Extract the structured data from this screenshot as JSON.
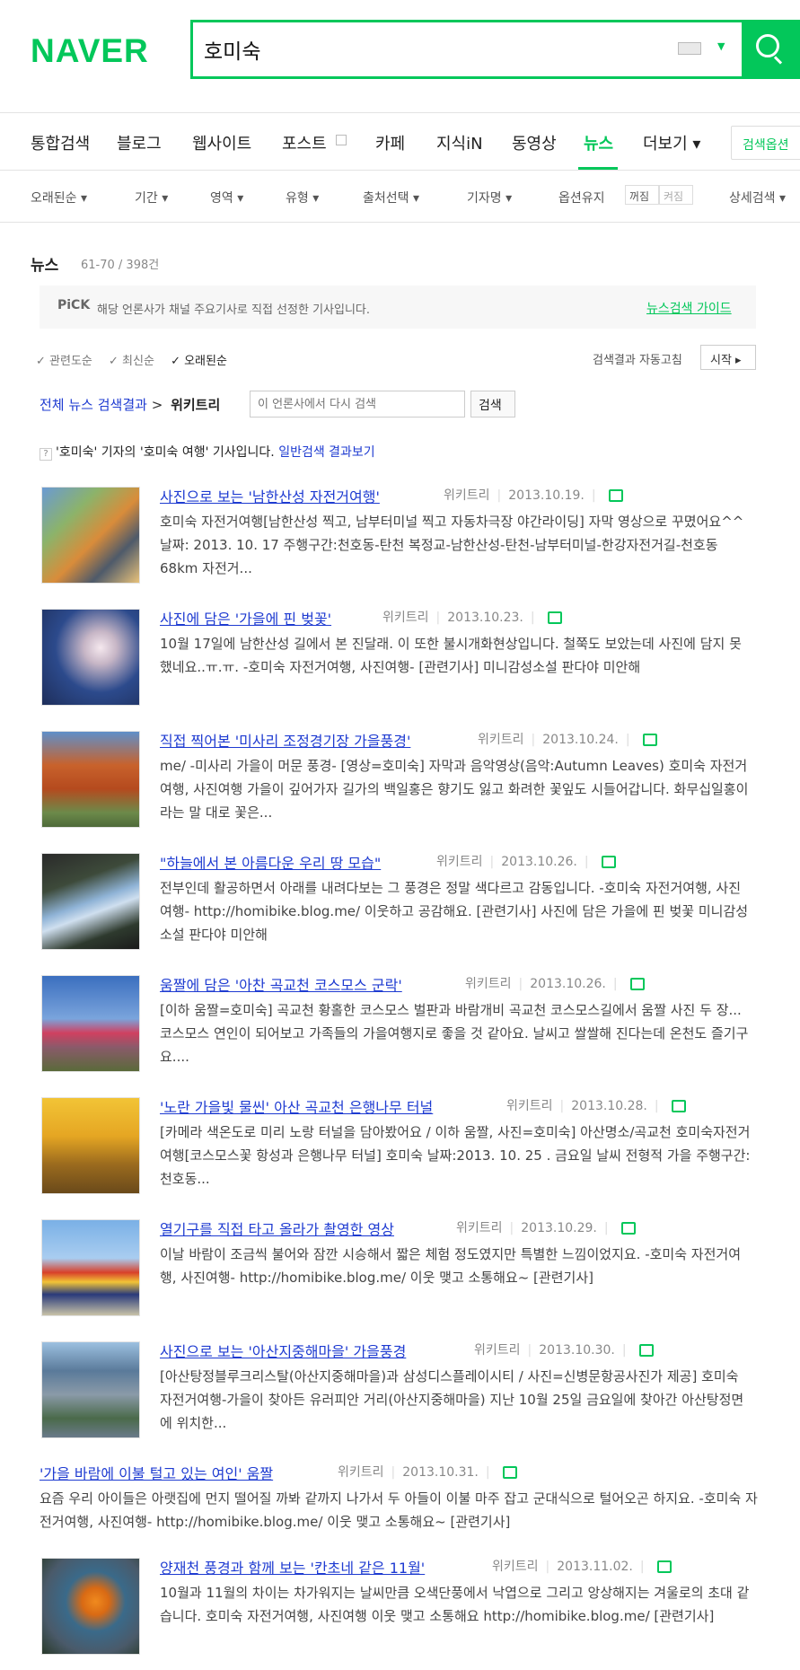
{
  "header": {
    "logo": "NAVER",
    "query": "호미숙"
  },
  "tabs": [
    "통합검색",
    "블로그",
    "웹사이트",
    "포스트",
    "카페",
    "지식iN",
    "동영상",
    "뉴스",
    "더보기 ▾"
  ],
  "search_options_label": "검색옵션",
  "filters": [
    "오래된순 ▾",
    "기간 ▾",
    "영역 ▾",
    "유형 ▾",
    "출처선택 ▾",
    "기자명 ▾",
    "옵션유지",
    "상세검색 ▾"
  ],
  "toggle": {
    "on": "꺼짐",
    "off": "켜짐"
  },
  "section": {
    "title": "뉴스",
    "count": "61-70 / 398건"
  },
  "pick": {
    "badge": "PiCK",
    "text": "해당 언론사가 채널 주요기사로 직접 선정한 기사입니다.",
    "guide": "뉴스검색 가이드"
  },
  "sort": {
    "relevance": "✓ 관련도순",
    "latest": "✓ 최신순",
    "oldest": "✓ 오래된순"
  },
  "auto_refresh": {
    "label": "검색결과 자동고침",
    "start": "시작 ▸"
  },
  "breadcrumb": {
    "all": "전체 뉴스 검색결과",
    "sep": ">",
    "current": "위키트리"
  },
  "research": {
    "placeholder": "이 언론사에서 다시 검색",
    "button": "검색"
  },
  "notice": {
    "pre": "'호미숙' 기자의 '호미숙 여행' 기사입니다.",
    "link": "일반검색 결과보기"
  },
  "results": [
    {
      "title": "사진으로 보는 '남한산성 자전거여행'",
      "source": "위키트리",
      "date": "2013.10.19.",
      "desc": "호미숙 자전거여행[남한산성 찍고, 남부터미널 찍고 자동차극장 야간라이딩] 자막 영상으로 꾸몄어요^^ 날짜: 2013. 10. 17 주행구간:천호동-탄천 복정교-남한산성-탄천-남부터미널-한강자전거길-천호동 68km 자전거..."
    },
    {
      "title": "사진에 담은 '가을에 핀 벚꽃'",
      "source": "위키트리",
      "date": "2013.10.23.",
      "desc": "10월 17일에 남한산성 길에서 본 진달래. 이 또한 불시개화현상입니다. 철쭉도 보았는데 사진에 담지 못했네요..ㅠ.ㅠ. -호미숙 자전거여행, 사진여행- [관련기사] 미니감성소설 판다야 미안해"
    },
    {
      "title": "직접 찍어본 '미사리 조정경기장 가을풍경'",
      "source": "위키트리",
      "date": "2013.10.24.",
      "desc": "me/ -미사리 가을이 머문 풍경- [영상=호미숙] 자막과 음악영상(음악:Autumn Leaves) 호미숙 자전거여행, 사진여행 가을이 깊어가자 길가의 백일홍은 향기도 잃고 화려한 꽃잎도 시들어갑니다. 화무십일홍이라는 말 대로 꽃은..."
    },
    {
      "title": "\"하늘에서 본 아름다운 우리 땅 모습\"",
      "source": "위키트리",
      "date": "2013.10.26.",
      "desc": "전부인데 활공하면서 아래를 내려다보는 그 풍경은 정말 색다르고 감동입니다. -호미숙 자전거여행, 사진여행- http://homibike.blog.me/ 이웃하고 공감해요. [관련기사] 사진에 담은 가을에 핀 벚꽃 미니감성소설 판다야 미안해"
    },
    {
      "title": "움짤에 담은 '아찬 곡교천 코스모스 군락'",
      "source": "위키트리",
      "date": "2013.10.26.",
      "desc": "[이하 움짤=호미숙] 곡교천 황홀한 코스모스 벌판과 바람개비 곡교천 코스모스길에서 움짤 사진 두 장... 코스모스 연인이 되어보고 가족들의 가을여행지로 좋을 것 같아요. 날씨고 쌀쌀해 진다는데 온천도 즐기구요...."
    },
    {
      "title": "'노란 가을빛 물씬' 아산 곡교천 은행나무 터널",
      "source": "위키트리",
      "date": "2013.10.28.",
      "desc": "[카메라 색온도로 미리 노랑 터널을 담아봤어요 / 이하 움짤, 사진=호미숙] 아산명소/곡교천 호미숙자전거여행[코스모스꽃 항성과 은행나무 터널] 호미숙 날짜:2013. 10. 25 . 금요일 날씨 전형적 가을 주행구간:천호동..."
    },
    {
      "title": "열기구를 직접 타고 올라가 촬영한 영상",
      "source": "위키트리",
      "date": "2013.10.29.",
      "desc": "이날 바람이 조금씩 불어와 잠깐 시승해서 짧은 체험 정도였지만 특별한 느낌이었지요. -호미숙 자전거여행, 사진여행- http://homibike.blog.me/ 이웃 맺고 소통해요~ [관련기사]"
    },
    {
      "title": "사진으로 보는 '아산지중해마을' 가을풍경",
      "source": "위키트리",
      "date": "2013.10.30.",
      "desc": "[아산탕정블루크리스탈(아산지중해마을)과 삼성디스플레이시티 / 사진=신병문항공사진가 제공] 호미숙 자전거여행-가을이 찾아든 유러피안 거리(아산지중해마을) 지난 10월 25일 금요일에 찾아간 아산탕정면에 위치한..."
    },
    {
      "title": "'가을 바람에 이불 털고 있는 여인' 움짤",
      "source": "위키트리",
      "date": "2013.10.31.",
      "desc": "요즘 우리 아이들은 아랫집에 먼지 떨어질 까봐 같까지 나가서 두 아들이 이불 마주 잡고 군대식으로 털어오곤 하지요. -호미숙 자전거여행, 사진여행- http://homibike.blog.me/ 이웃 맺고 소통해요~ [관련기사]"
    },
    {
      "title": "양재천 풍경과 함께 보는 '칸초네 같은 11월'",
      "source": "위키트리",
      "date": "2013.11.02.",
      "desc": "10월과 11월의 차이는 차가워지는 날씨만큼 오색단풍에서 낙엽으로 그리고 앙상해지는 겨울로의 초대 같습니다. 호미숙 자전거여행, 사진여행 이웃 맺고 소통해요 http://homibike.blog.me/ [관련기사]"
    }
  ]
}
